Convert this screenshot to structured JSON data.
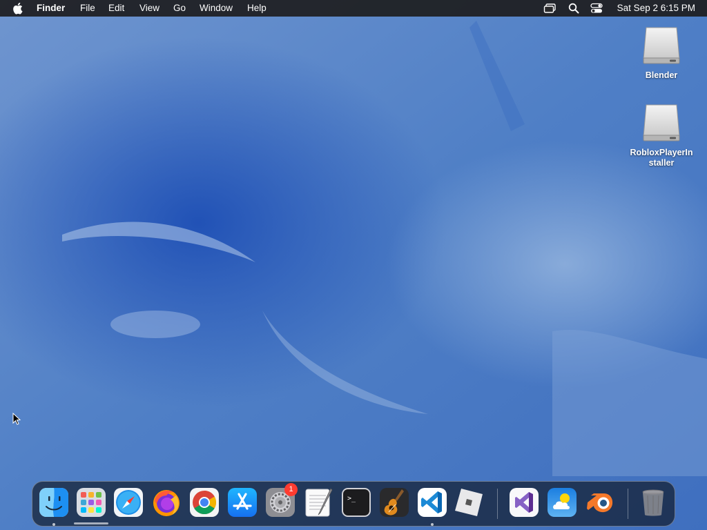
{
  "menubar": {
    "app_name": "Finder",
    "items": [
      "File",
      "Edit",
      "View",
      "Go",
      "Window",
      "Help"
    ],
    "clock": "Sat Sep 2  6:15 PM",
    "status_icons": [
      "screen-mirroring-icon",
      "spotlight-search-icon",
      "control-center-icon"
    ]
  },
  "desktop": {
    "icons": [
      {
        "label": "Blender",
        "icon": "disk-image-icon"
      },
      {
        "label": "RobloxPlayerInstaller",
        "icon": "disk-image-icon"
      }
    ]
  },
  "dock": {
    "apps": [
      {
        "name": "Finder",
        "icon": "finder-icon",
        "running": true
      },
      {
        "name": "Launchpad",
        "icon": "launchpad-icon",
        "running": false
      },
      {
        "name": "Safari",
        "icon": "safari-icon",
        "running": false
      },
      {
        "name": "Firefox",
        "icon": "firefox-icon",
        "running": false
      },
      {
        "name": "Google Chrome",
        "icon": "chrome-icon",
        "running": false
      },
      {
        "name": "App Store",
        "icon": "app-store-icon",
        "running": false
      },
      {
        "name": "System Settings",
        "icon": "system-settings-icon",
        "running": false,
        "badge": "1"
      },
      {
        "name": "TextEdit",
        "icon": "textedit-icon",
        "running": false
      },
      {
        "name": "Terminal",
        "icon": "terminal-icon",
        "running": false
      },
      {
        "name": "GarageBand",
        "icon": "garageband-icon",
        "running": false
      },
      {
        "name": "Visual Studio Code",
        "icon": "vscode-icon",
        "running": true
      },
      {
        "name": "Roblox",
        "icon": "roblox-icon",
        "running": false
      },
      {
        "name": "Visual Studio",
        "icon": "visual-studio-icon",
        "running": false
      },
      {
        "name": "Weather",
        "icon": "weather-icon",
        "running": false
      },
      {
        "name": "Blender",
        "icon": "blender-icon",
        "running": false
      },
      {
        "name": "Trash",
        "icon": "trash-icon",
        "running": false
      }
    ],
    "terminal_prompt": ">_"
  },
  "colors": {
    "menubar_bg": "#1e1e20",
    "wallpaper": "#4a7cc4",
    "badge": "#ff3b30"
  }
}
